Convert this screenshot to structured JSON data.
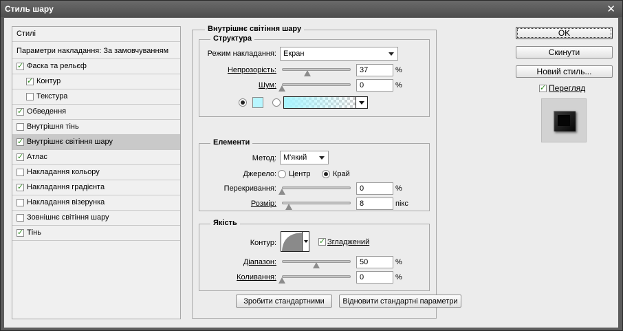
{
  "window": {
    "title": "Стиль шару",
    "close_glyph": "✕"
  },
  "styles_panel": {
    "header": "Стилі",
    "blending_options": "Параметри накладання: За замовчуванням",
    "items": [
      {
        "label": "Фаска та рельєф",
        "checked": true
      },
      {
        "label": "Контур",
        "checked": true
      },
      {
        "label": "Текстура",
        "checked": false
      },
      {
        "label": "Обведення",
        "checked": true
      },
      {
        "label": "Внутрішня тінь",
        "checked": false
      },
      {
        "label": "Внутрішнє світіння шару",
        "checked": true,
        "selected": true
      },
      {
        "label": "Атлас",
        "checked": true
      },
      {
        "label": "Накладання кольору",
        "checked": false
      },
      {
        "label": "Накладання градієнта",
        "checked": true
      },
      {
        "label": "Накладання візерунка",
        "checked": false
      },
      {
        "label": "Зовнішнє світіння шару",
        "checked": false
      },
      {
        "label": "Тінь",
        "checked": true
      }
    ]
  },
  "inner_glow": {
    "title": "Внутрішнє світіння шару",
    "structure": {
      "legend": "Структура",
      "blend_mode_label": "Режим накладання:",
      "blend_mode_value": "Екран",
      "opacity_label": "Непрозорість:",
      "opacity_value": "37",
      "opacity_unit": "%",
      "opacity_level": 0.37,
      "noise_label": "Шум:",
      "noise_value": "0",
      "noise_unit": "%",
      "noise_level": 0,
      "glow_color": "#b8f6ff"
    },
    "elements": {
      "legend": "Елементи",
      "technique_label": "Метод:",
      "technique_value": "М'який",
      "source_label": "Джерело:",
      "source_center": "Центр",
      "source_edge": "Край",
      "choke_label": "Перекривання:",
      "choke_value": "0",
      "choke_unit": "%",
      "choke_level": 0,
      "size_label": "Розмір:",
      "size_value": "8",
      "size_unit": "пікс"
    },
    "quality": {
      "legend": "Якість",
      "contour_label": "Контур:",
      "antialiased_label": "Згладжений",
      "antialiased_checked": true,
      "range_label": "Діапазон:",
      "range_value": "50",
      "range_unit": "%",
      "range_level": 0.5,
      "jitter_label": "Коливання:",
      "jitter_value": "0",
      "jitter_unit": "%",
      "jitter_level": 0
    },
    "make_default": "Зробити стандартними",
    "reset_default": "Відновити стандартні параметри"
  },
  "actions": {
    "ok": "OK",
    "reset": "Скинути",
    "new_style": "Новий стиль...",
    "preview_label": "Перегляд",
    "preview_checked": true
  }
}
